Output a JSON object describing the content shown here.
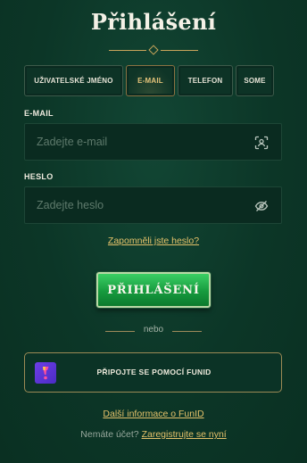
{
  "title": "Přihlášení",
  "tabs": [
    {
      "label": "UŽIVATELSKÉ JMÉNO",
      "active": false
    },
    {
      "label": "E-MAIL",
      "active": true
    },
    {
      "label": "TELEFON",
      "active": false
    },
    {
      "label": "SOME",
      "active": false
    }
  ],
  "email": {
    "label": "E-MAIL",
    "placeholder": "Zadejte e-mail",
    "value": "",
    "icon": "scan-icon"
  },
  "password": {
    "label": "HESLO",
    "placeholder": "Zadejte heslo",
    "value": "",
    "icon": "eye-off-icon"
  },
  "forgot_link": "Zapomněli jste heslo?",
  "login_button": "PŘIHLÁŠENÍ",
  "divider_text": "nebo",
  "funid_button": {
    "label": "PŘIPOJTE SE POMOCÍ FUNID",
    "icon": "funid-logo-icon"
  },
  "more_info_link": "Další informace o FunID",
  "register": {
    "prompt": "Nemáte účet?",
    "link": "Zaregistrujte se nyní"
  },
  "colors": {
    "background": "#0c3627",
    "accent_gold": "#e5c26a",
    "button_green": "#169a3e",
    "funid_purple": "#6d3ee6"
  }
}
